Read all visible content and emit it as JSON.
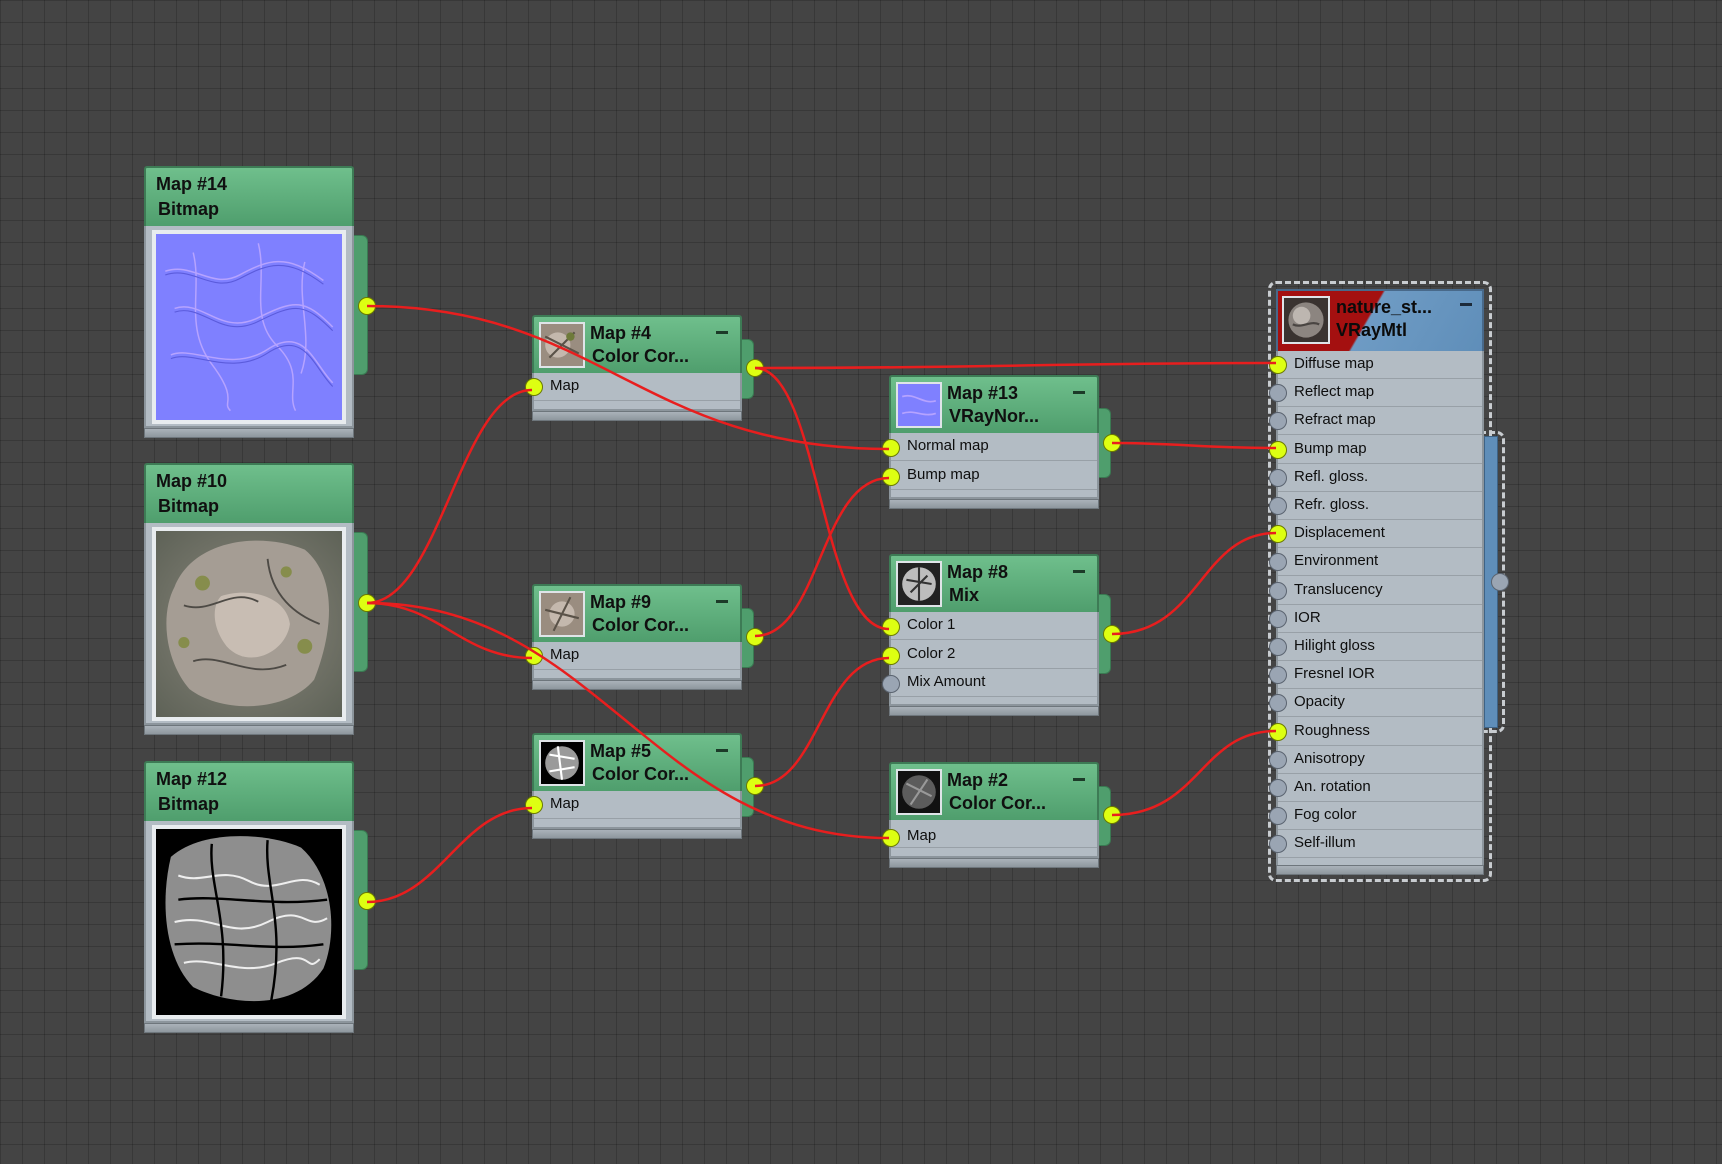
{
  "nodes": {
    "map14": {
      "name": "Map #14",
      "type": "Bitmap"
    },
    "map10": {
      "name": "Map #10",
      "type": "Bitmap"
    },
    "map12": {
      "name": "Map #12",
      "type": "Bitmap"
    },
    "map4": {
      "name": "Map #4",
      "type": "Color Cor...",
      "slot": "Map"
    },
    "map9": {
      "name": "Map #9",
      "type": "Color Cor...",
      "slot": "Map"
    },
    "map5": {
      "name": "Map #5",
      "type": "Color Cor...",
      "slot": "Map"
    },
    "map13": {
      "name": "Map #13",
      "type": "VRayNor...",
      "slots": [
        "Normal map",
        "Bump map"
      ]
    },
    "map8": {
      "name": "Map #8",
      "type": "Mix",
      "slots": [
        "Color 1",
        "Color 2",
        "Mix Amount"
      ]
    },
    "map2": {
      "name": "Map #2",
      "type": "Color Cor...",
      "slot": "Map"
    },
    "material": {
      "name": "nature_st...",
      "type": "VRayMtl",
      "slots": [
        "Diffuse map",
        "Reflect map",
        "Refract map",
        "Bump map",
        "Refl. gloss.",
        "Refr. gloss.",
        "Displacement",
        "Environment",
        "Translucency",
        "IOR",
        "Hilight gloss",
        "Fresnel IOR",
        "Opacity",
        "Roughness",
        "Anisotropy",
        "An. rotation",
        "Fog color",
        "Self-illum"
      ],
      "connected": [
        "Diffuse map",
        "Bump map",
        "Displacement",
        "Roughness"
      ]
    }
  },
  "colors": {
    "background": "#444444",
    "wire": "#e81e1e",
    "socket_connected": "#ddff12",
    "socket_empty": "#9aa5b3",
    "node_header": "#5fae7c",
    "node_body": "#b3bcc4",
    "material_header_red": "#a41010",
    "material_header_blue": "#6e9bc4"
  }
}
